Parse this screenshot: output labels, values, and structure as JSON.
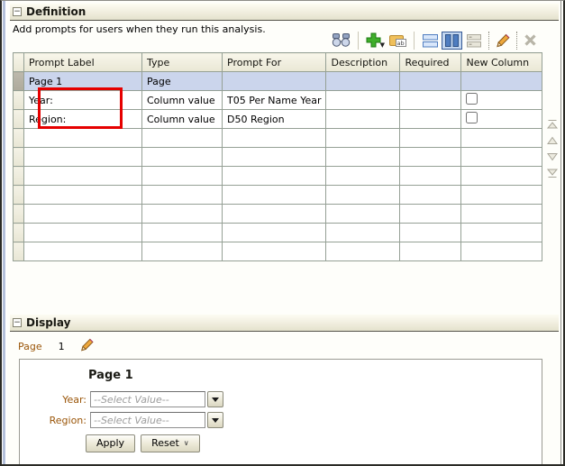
{
  "definition": {
    "header": {
      "title": "Definition",
      "collapse_glyph": "−"
    },
    "subtitle": "Add prompts for users when they run this analysis.",
    "toolbar": {
      "icons": [
        "preview-binoculars",
        "new-prompt-plus",
        "label-page",
        "rows-layout",
        "columns-layout-selected",
        "compound-layout-disabled",
        "edit-pencil",
        "delete-x-disabled"
      ],
      "label_icon_text": "ab",
      "selected_layout": "columns"
    },
    "table": {
      "columns": [
        "Prompt Label",
        "Type",
        "Prompt For",
        "Description",
        "Required",
        "New Column"
      ],
      "rows": [
        {
          "label": "Page 1",
          "type": "Page",
          "prompt_for": "",
          "description": "",
          "required": "",
          "selected": true,
          "new_column_checkbox": false
        },
        {
          "label": "Year:",
          "type": "Column value",
          "prompt_for": "T05 Per Name Year",
          "description": "",
          "required": "",
          "selected": false,
          "new_column_checkbox": true
        },
        {
          "label": "Region:",
          "type": "Column value",
          "prompt_for": "D50 Region",
          "description": "",
          "required": "",
          "selected": false,
          "new_column_checkbox": true
        }
      ],
      "empty_row_count": 7
    },
    "reorder_buttons": [
      "move-to-top",
      "move-up",
      "move-down",
      "move-to-bottom"
    ]
  },
  "annotation": {
    "shape": "red-rectangle",
    "color": "#e60000",
    "around": "Year: and Region: prompt labels"
  },
  "display": {
    "header": {
      "title": "Display",
      "collapse_glyph": "−"
    },
    "page_label": "Page",
    "page_number": "1",
    "preview": {
      "heading": "Page 1",
      "fields": [
        {
          "label": "Year:",
          "placeholder": "--Select Value--"
        },
        {
          "label": "Region:",
          "placeholder": "--Select Value--"
        }
      ],
      "apply": "Apply",
      "reset": "Reset",
      "reset_caret": "∨"
    }
  },
  "colors": {
    "selected_row": "#cbd5ec",
    "annotation_red": "#e60000",
    "label_brown": "#9a5508",
    "toolbar_selected_bg": "#c3d6ef",
    "section_header_bg": "#efecdc"
  }
}
